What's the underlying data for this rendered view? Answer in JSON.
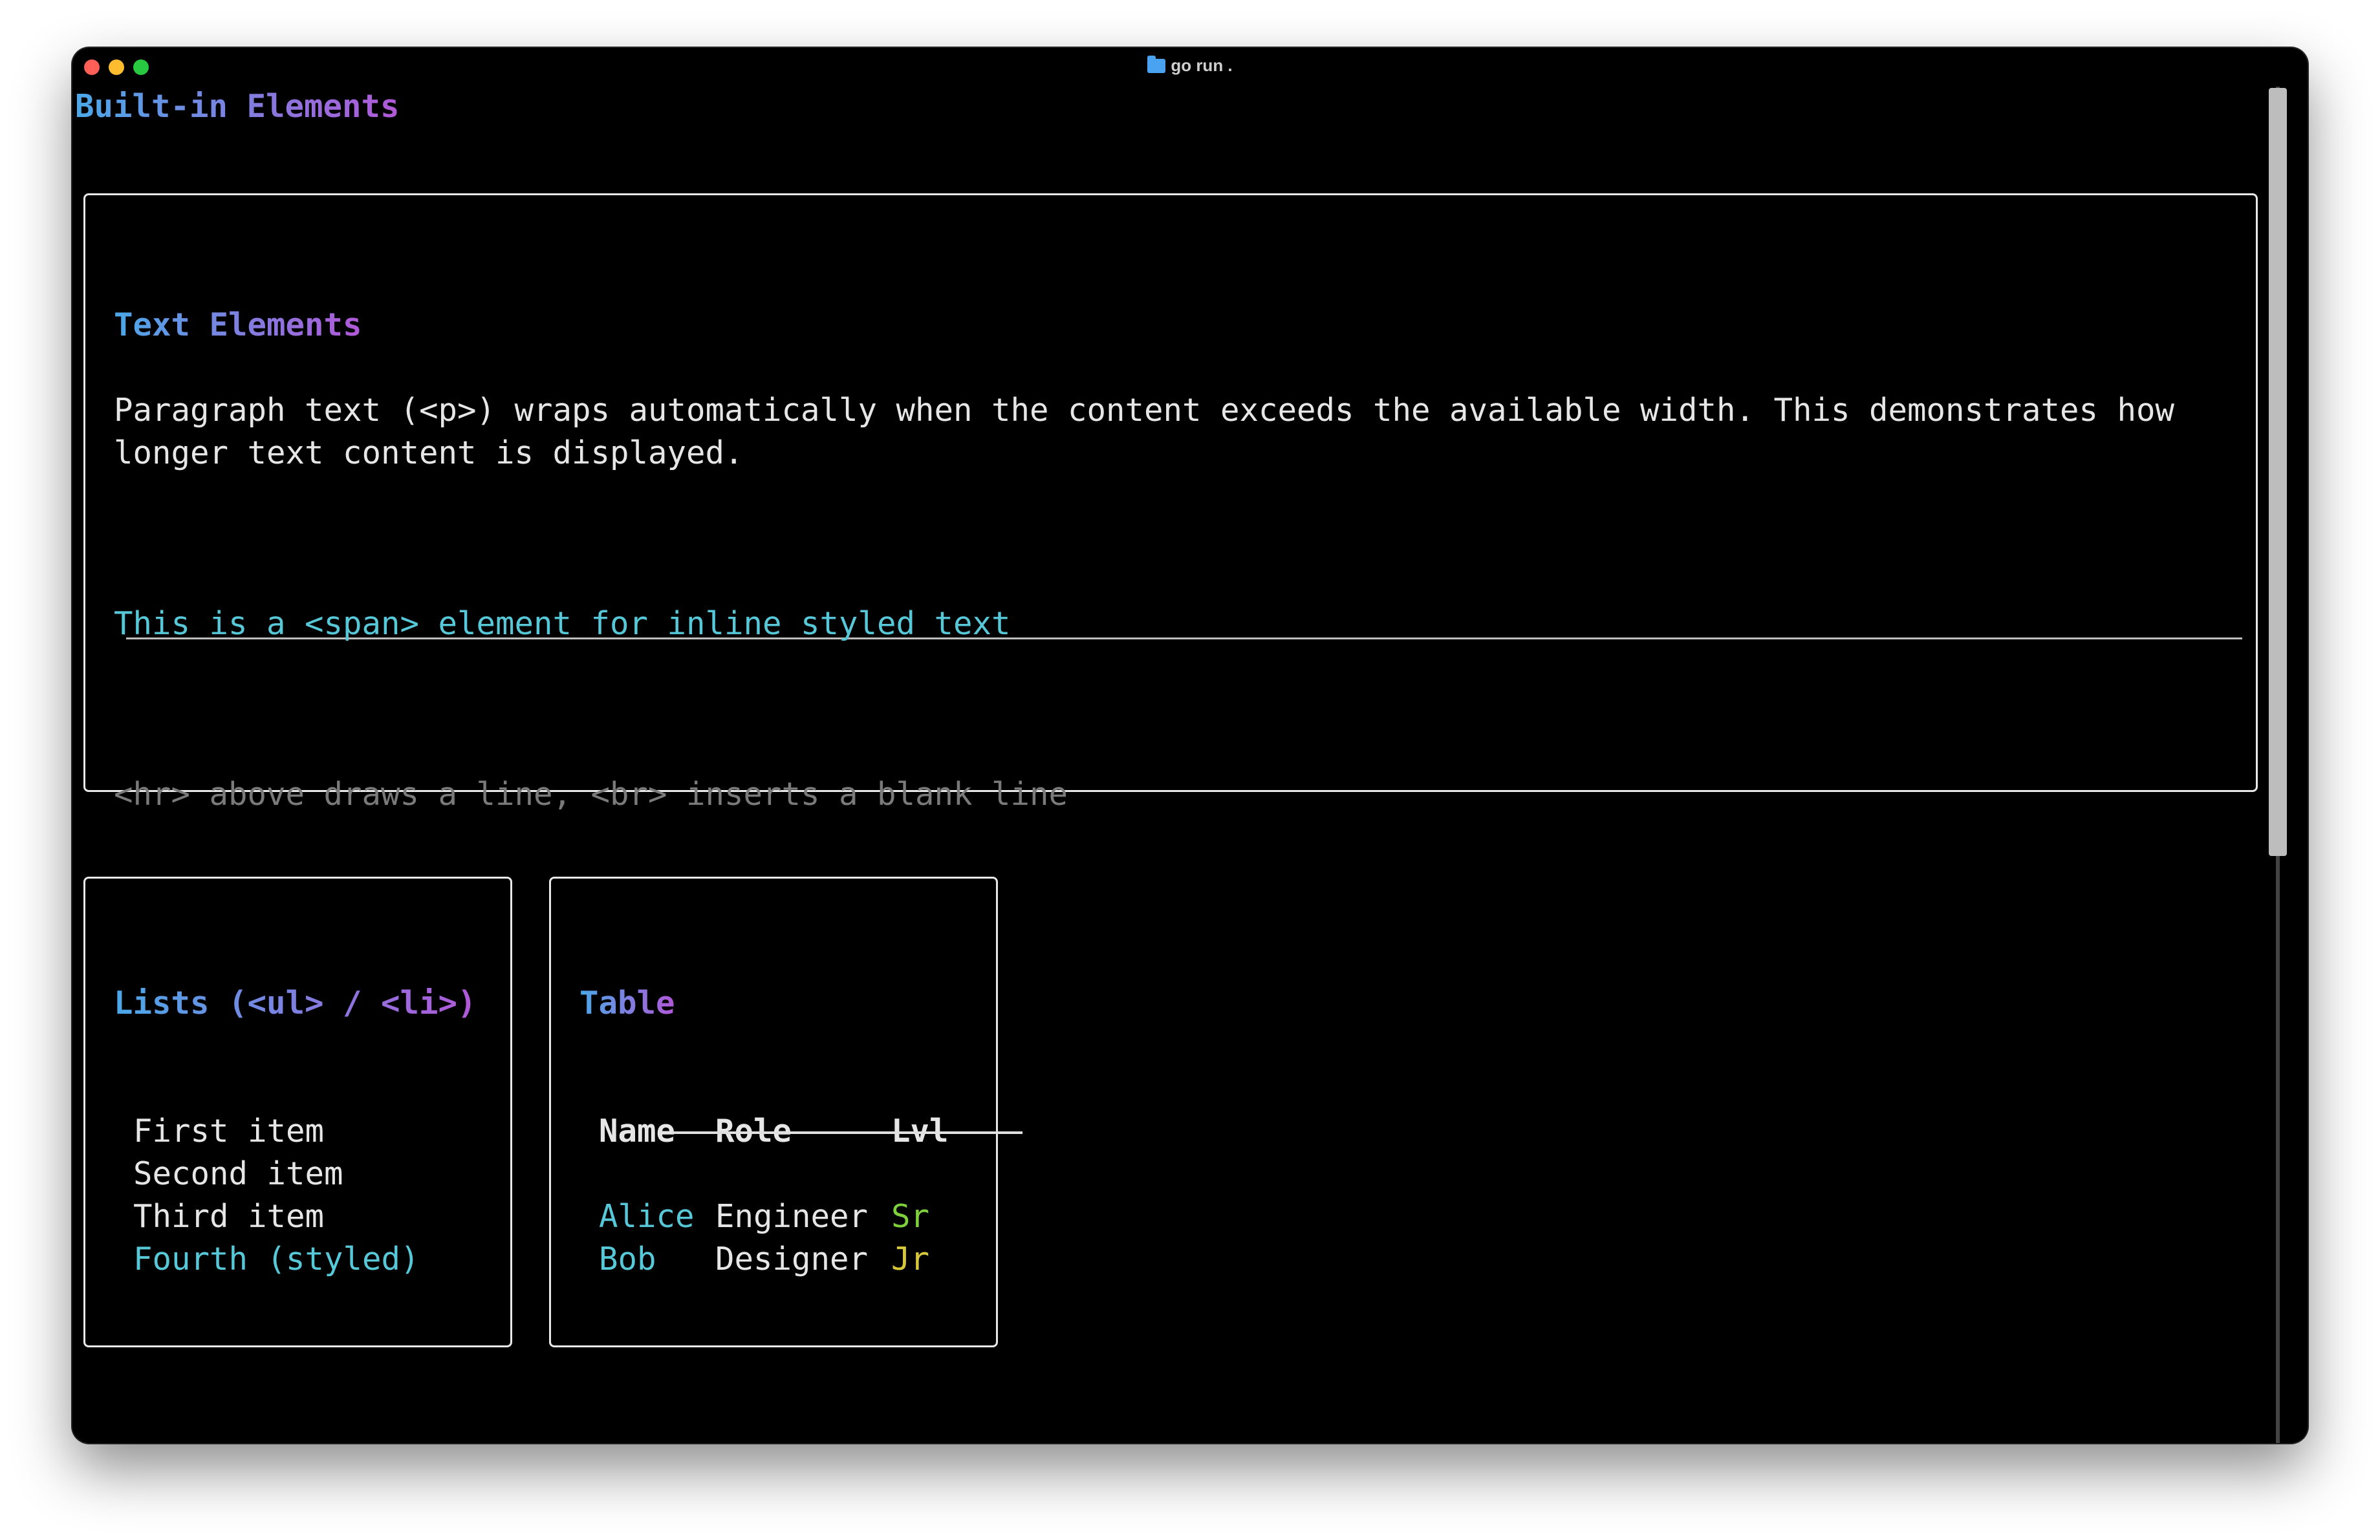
{
  "window": {
    "title": "go run ."
  },
  "app": {
    "title": "Built-in Elements"
  },
  "text_section": {
    "heading": "Text Elements",
    "paragraph_line1": "Paragraph text (<p>) wraps automatically when the content exceeds the available width. This demonstrates how",
    "paragraph_line2": "longer text content is displayed.",
    "span_text": "This is a <span> element for inline styled text",
    "note": "<hr> above draws a line, <br> inserts a blank line"
  },
  "lists_section": {
    "heading": "Lists (<ul> / <li>)",
    "items": [
      "First item",
      "Second item",
      "Third item",
      "Fourth (styled)"
    ]
  },
  "table_section": {
    "heading": "Table",
    "columns": [
      "Name",
      "Role",
      "Lvl"
    ],
    "rows": [
      {
        "name": "Alice",
        "role": "Engineer",
        "lvl": "Sr"
      },
      {
        "name": "Bob",
        "role": "Designer",
        "lvl": "Jr"
      }
    ]
  },
  "colors": {
    "heading_gradient_start": "#4aa8e8",
    "heading_gradient_end": "#b258d8",
    "accent_cyan": "#56c8d8",
    "muted_gray": "#7a7a7a",
    "level_sr": "#7fd13b",
    "level_jr": "#d7c83a"
  }
}
